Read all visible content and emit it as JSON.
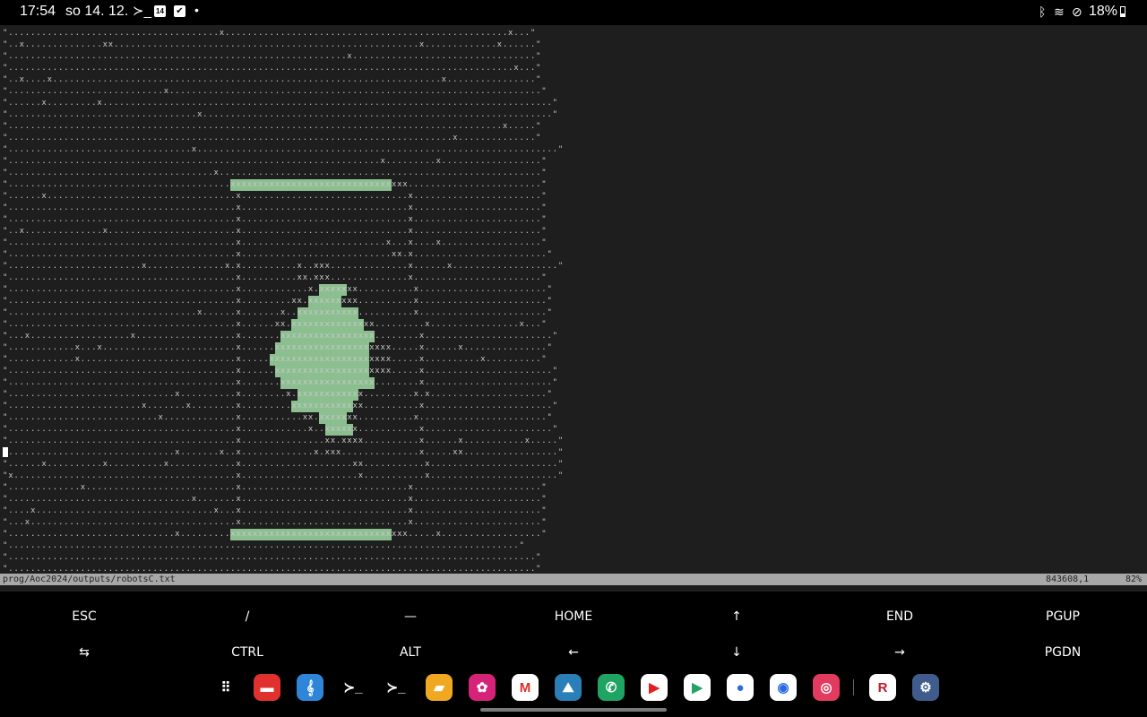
{
  "status_bar": {
    "time": "17:54",
    "date": "so 14. 12.",
    "notification_icons": [
      "terminal-icon",
      "calendar-icon",
      "task-check-icon",
      "dot-icon"
    ],
    "calendar_day": "14",
    "system_icons": [
      "bluetooth-icon",
      "wifi-icon",
      "do-not-disturb-icon"
    ],
    "battery": "18%"
  },
  "terminal": {
    "file_path": "prog/Aoc2024/outputs/robotsC.txt",
    "cursor_position": "843608,1",
    "scroll_percent": "82%",
    "grid_columns": 101,
    "grid_rows": 47,
    "cursor_row": 36,
    "rows": [
      "\"......................................x...................................................x...\"",
      "\"..x..............xx.......................................................x.............x......\"",
      "\".............................................................x.................................\"",
      "\"...........................................................................................x...\"",
      "\"..x....x......................................................................x................\"",
      "\"............................x...................................................................\"",
      "\"......x.........x.................................................................................\"",
      "\"..................................x...............................................................\"",
      "\".........................................................................................x.....\"",
      "\"................................................................................x..............\"",
      "\".................................x.................................................................\"",
      "\"...................................................................x.........x..................\"",
      "\".....................................x..........................................................\"",
      "\"........................................XXXXXXXXXXXXXXXXXXXXXXXXXXXXXxxx........................\"",
      "\"......x..................................x..............................x.......................\"",
      "\".........................................x..............................x.......................\"",
      "\".........................................x..............................x.......................\"",
      "\"..x..............x.......................x..............................x.......................\"",
      "\".........................................x..........................x...x....x..................\"",
      "\".........................................x...........................xx.x........................\"",
      "\"........................x..............x.x..........x..xxx..............x......x...................\"",
      "\".........................................x..........xx.xxx..............x.......................\"",
      "\".........................................x............x.XXXXXxx..........x.......................\"",
      "\".........................................x.........xx.XXXXXXxxx..........x.......................\"",
      "\"..................................x......x.......x..XXXXXXXXXXX..........x.......................\"",
      "\".........................................x......xx.XXXXXXXXXXXXXxx.........x................x...\"",
      "\"...x..................x..................x.......XXXXXXXXXXXXXXXXX........x.......................\"",
      "\"............x...x........................x......XXXXXXXXXXXXXXXXXxxxx.....x......x...............\"",
      "\"............x............................x.....XXXXXXXXXXXXXXXXXXxxxx.....x..........x..........\"",
      "\".........................................x......XXXXXXXXXXXXXXXXXxxxx.....x.......................\"",
      "\".........................................x.......XXXXXXXXXXXXXXXXX........x.......................\"",
      "\"..............................x..........x........x.XXXXXXXXXXXx.........x.x.....................\"",
      "\"........................x.......x........x.........XXXXXXXXXXXxx..........x.......................\"",
      "\"...........................x.............x...........xx.XXXXXxx..........x.......................\"",
      "\".........................................x............x..XXXXXx...........x.......................\"",
      "\".........................................x...............xx.xxxx..........x......x...........x.....\"",
      "\"..............................x.......x..x.............x.xxx..............x.....xx.................\"",
      "\"......x..........x..........x............x....................xx...........x.......................\"",
      "\"x........................................x.....................x...........x.......................\"",
      "\".............x...........................x..............................x.......................\"",
      "\".................................x.......x..............................x.......................\"",
      "\"....x................................x...x..............................x.......................\"",
      "\"...x.....................................x..............................x.......................\"",
      "\"..............................x.........XXXXXXXXXXXXXXXXXXXXXXXXXXXXXxxx.....x..................\"",
      "\"............................................................................................\"",
      "\"...............................................................................................\"",
      "\"...............................................................................................\""
    ]
  },
  "extra_keys": [
    [
      "ESC",
      "/",
      "—",
      "HOME",
      "↑",
      "END",
      "PGUP"
    ],
    [
      "⇆",
      "CTRL",
      "ALT",
      "←",
      "↓",
      "→",
      "PGDN"
    ]
  ],
  "dock": {
    "apps": [
      {
        "icon": "app-drawer-icon",
        "glyph": "⠿",
        "color": "#000000"
      },
      {
        "icon": "notes-app-icon",
        "glyph": "▬",
        "color": "#e0312f"
      },
      {
        "icon": "music-app-icon",
        "glyph": "𝄞",
        "color": "#2f86d8"
      },
      {
        "icon": "terminal-app-icon",
        "glyph": "≻_",
        "color": "#000000"
      },
      {
        "icon": "terminal-app-icon-2",
        "glyph": "≻_",
        "color": "#000000"
      },
      {
        "icon": "files-app-icon",
        "glyph": "▰",
        "color": "#f1a821"
      },
      {
        "icon": "flower-app-icon",
        "glyph": "✿",
        "color": "#d6237a"
      },
      {
        "icon": "gmail-app-icon",
        "glyph": "M",
        "color": "#ffffff"
      },
      {
        "icon": "climbing-app-icon",
        "glyph": "⛰",
        "color": "#2a7fb6"
      },
      {
        "icon": "phone-app-icon",
        "glyph": "✆",
        "color": "#1fa463"
      },
      {
        "icon": "youtube-app-icon",
        "glyph": "▶",
        "color": "#ffffff"
      },
      {
        "icon": "play-store-app-icon",
        "glyph": "▶",
        "color": "#ffffff"
      },
      {
        "icon": "messages-app-icon",
        "glyph": "●",
        "color": "#ffffff"
      },
      {
        "icon": "chrome-app-icon",
        "glyph": "◉",
        "color": "#ffffff"
      },
      {
        "icon": "camera-app-icon",
        "glyph": "◎",
        "color": "#e23b5f"
      },
      {
        "icon": "rakuten-app-icon",
        "glyph": "R",
        "color": "#ffffff"
      },
      {
        "icon": "settings-app-icon",
        "glyph": "⚙",
        "color": "#3f5c8c"
      }
    ]
  }
}
